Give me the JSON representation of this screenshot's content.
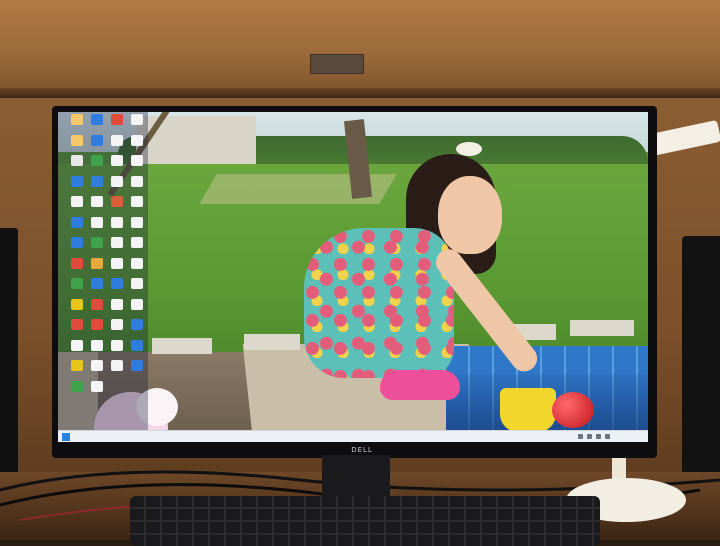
{
  "scene": {
    "description_free": true,
    "monitor_brand": "DELL"
  },
  "desktop": {
    "icon_count": 58,
    "icons": [
      {
        "color": "#f5c86a",
        "label": ""
      },
      {
        "color": "#2f7de1",
        "label": ""
      },
      {
        "color": "#e04b3c",
        "label": ""
      },
      {
        "color": "#f4f4f4",
        "label": ""
      },
      {
        "color": "#f5c86a",
        "label": ""
      },
      {
        "color": "#2f7de1",
        "label": ""
      },
      {
        "color": "#f4f4f4",
        "label": ""
      },
      {
        "color": "#f4f4f4",
        "label": ""
      },
      {
        "color": "#e8e8e8",
        "label": ""
      },
      {
        "color": "#3ea34a",
        "label": ""
      },
      {
        "color": "#f4f4f4",
        "label": ""
      },
      {
        "color": "#f4f4f4",
        "label": ""
      },
      {
        "color": "#2f7de1",
        "label": ""
      },
      {
        "color": "#2f7de1",
        "label": ""
      },
      {
        "color": "#f4f4f4",
        "label": ""
      },
      {
        "color": "#f4f4f4",
        "label": ""
      },
      {
        "color": "#f4f4f4",
        "label": ""
      },
      {
        "color": "#f4f4f4",
        "label": ""
      },
      {
        "color": "#d95f3b",
        "label": ""
      },
      {
        "color": "#f4f4f4",
        "label": ""
      },
      {
        "color": "#2f7de1",
        "label": ""
      },
      {
        "color": "#f4f4f4",
        "label": ""
      },
      {
        "color": "#f4f4f4",
        "label": ""
      },
      {
        "color": "#f4f4f4",
        "label": ""
      },
      {
        "color": "#2f7de1",
        "label": ""
      },
      {
        "color": "#3ea34a",
        "label": ""
      },
      {
        "color": "#f4f4f4",
        "label": ""
      },
      {
        "color": "#f4f4f4",
        "label": ""
      },
      {
        "color": "#e04b3c",
        "label": ""
      },
      {
        "color": "#e8a93a",
        "label": ""
      },
      {
        "color": "#f4f4f4",
        "label": ""
      },
      {
        "color": "#f4f4f4",
        "label": ""
      },
      {
        "color": "#3ea34a",
        "label": ""
      },
      {
        "color": "#2f7de1",
        "label": ""
      },
      {
        "color": "#2f7de1",
        "label": ""
      },
      {
        "color": "#f4f4f4",
        "label": ""
      },
      {
        "color": "#e8c51a",
        "label": ""
      },
      {
        "color": "#e04b3c",
        "label": ""
      },
      {
        "color": "#f4f4f4",
        "label": ""
      },
      {
        "color": "#f4f4f4",
        "label": ""
      },
      {
        "color": "#e04b3c",
        "label": ""
      },
      {
        "color": "#e04b3c",
        "label": ""
      },
      {
        "color": "#f4f4f4",
        "label": ""
      },
      {
        "color": "#2f7de1",
        "label": ""
      },
      {
        "color": "#f4f4f4",
        "label": ""
      },
      {
        "color": "#f4f4f4",
        "label": ""
      },
      {
        "color": "#f4f4f4",
        "label": ""
      },
      {
        "color": "#2f7de1",
        "label": ""
      },
      {
        "color": "#e8c51a",
        "label": ""
      },
      {
        "color": "#f4f4f4",
        "label": ""
      },
      {
        "color": "#f4f4f4",
        "label": ""
      },
      {
        "color": "#2f7de1",
        "label": ""
      },
      {
        "color": "#3ea34a",
        "label": ""
      },
      {
        "color": "#f4f4f4",
        "label": ""
      }
    ]
  },
  "taskbar": {
    "start_icon": "windows-start-icon",
    "tray": [
      "network-icon",
      "volume-icon",
      "ime-icon",
      "notification-icon"
    ],
    "clock_time": "",
    "clock_date": ""
  },
  "colors": {
    "wallpaper_grass": "#5e9a3a",
    "dress": "#5cc0b8",
    "shoes": "#ee4f9a",
    "ball": "#c2121b",
    "bucket": "#f2d62b",
    "pool": "#2f78c8"
  }
}
